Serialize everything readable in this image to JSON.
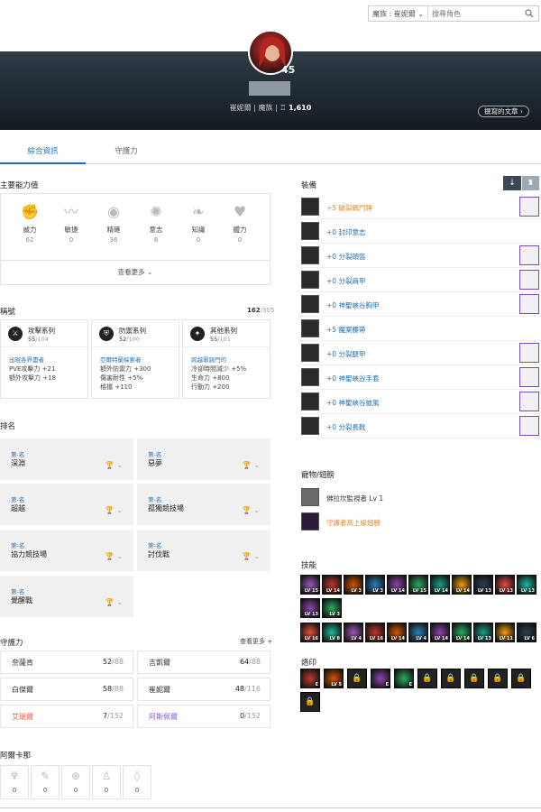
{
  "search": {
    "server": "魔族 : 崔妮爾 ⌄",
    "placeholder": "搜尋角色"
  },
  "profile": {
    "level": "45",
    "server": "崔妮爾",
    "race": "魔族",
    "sep": "|",
    "power": "1,610",
    "articles_button": "撰寫的文章 ›"
  },
  "tabs": [
    {
      "label": "綜合資訊"
    },
    {
      "label": "守護力"
    }
  ],
  "stats": {
    "title": "主要能力值",
    "items": [
      {
        "name": "威力",
        "value": "62"
      },
      {
        "name": "敏捷",
        "value": "0"
      },
      {
        "name": "精確",
        "value": "36"
      },
      {
        "name": "意志",
        "value": "8"
      },
      {
        "name": "知識",
        "value": "0"
      },
      {
        "name": "體力",
        "value": "0"
      }
    ],
    "more": "查看更多 ⌄"
  },
  "titles": {
    "title": "稱號",
    "count": "162",
    "total": "/305",
    "cards": [
      {
        "name": "攻擊系列",
        "count": "55",
        "total": "/104",
        "tag": "出現各界盡者",
        "lines": [
          "PVE攻擊力 +21",
          "額外攻擊力 +18"
        ]
      },
      {
        "name": "防禦系列",
        "count": "52",
        "total": "/100",
        "tag": "亞爾特蘭探索者",
        "lines": [
          "額外防禦力 +300",
          "傷害耐性 +5%",
          "格擋 +110"
        ]
      },
      {
        "name": "其他系列",
        "count": "55",
        "total": "/101",
        "tag": "跨越罪惡門的",
        "lines": [
          "冷卻時間減少 +5%",
          "生命力 +800",
          "行動力 +200"
        ]
      }
    ]
  },
  "ranking": {
    "title": "排名",
    "items": [
      {
        "label": "第-名",
        "name": "深淵",
        "trophy": "🏆 ⌄"
      },
      {
        "label": "第-名",
        "name": "惡夢",
        "trophy": "🏆 ⌄"
      },
      {
        "label": "第-名",
        "name": "超越",
        "trophy": "🏆 ⌄"
      },
      {
        "label": "第-名",
        "name": "孤獨競技場",
        "trophy": "🏆 ⌄"
      },
      {
        "label": "第-名",
        "name": "協力競技場",
        "trophy": "🏆 ⌄"
      },
      {
        "label": "第-名",
        "name": "討伐戰",
        "trophy": "🏆 ⌄"
      },
      {
        "label": "第-名",
        "name": "覺醒戰",
        "trophy": "🏆 ⌄"
      }
    ]
  },
  "guardian": {
    "title": "守護力",
    "more": "查看更多 +",
    "items": [
      {
        "name": "奈薩肯",
        "value": "52",
        "total": "/88",
        "color": "#333333"
      },
      {
        "name": "吉凱爾",
        "value": "64",
        "total": "/88",
        "color": "#333333"
      },
      {
        "name": "白傑爾",
        "value": "58",
        "total": "/88",
        "color": "#333333"
      },
      {
        "name": "崔妮爾",
        "value": "48",
        "total": "/116",
        "color": "#333333"
      },
      {
        "name": "艾瑞爾",
        "value": "7",
        "total": "/152",
        "color": "#e0614a"
      },
      {
        "name": "阿斯佩爾",
        "value": "0",
        "total": "/152",
        "color": "#8a5bd0"
      }
    ]
  },
  "cards": {
    "title": "阿爾卡那",
    "items": [
      {
        "value": "0"
      },
      {
        "value": "0"
      },
      {
        "value": "0"
      },
      {
        "value": "0"
      },
      {
        "value": "0"
      }
    ]
  },
  "equipment": {
    "title": "裝備",
    "items": [
      {
        "name": "+5 破裂戰鬥錘",
        "color": "#e08a2c",
        "side": true
      },
      {
        "name": "+0 封印意志",
        "color": "#1f6fb5",
        "side": false
      },
      {
        "name": "+0 分裂頭盔",
        "color": "#1f6fb5",
        "side": true
      },
      {
        "name": "+0 分裂肩甲",
        "color": "#1f6fb5",
        "side": true
      },
      {
        "name": "+0 神聖峽谷胸甲",
        "color": "#1f6fb5",
        "side": true
      },
      {
        "name": "+5 魔案腰帶",
        "color": "#1f6fb5",
        "side": false
      },
      {
        "name": "+0 分裂腿甲",
        "color": "#1f6fb5",
        "side": true
      },
      {
        "name": "+0 神聖峽谷手套",
        "color": "#1f6fb5",
        "side": true
      },
      {
        "name": "+0 神聖峽谷披風",
        "color": "#1f6fb5",
        "side": true
      },
      {
        "name": "+0 分裂長靴",
        "color": "#1f6fb5",
        "side": true
      }
    ]
  },
  "pets": {
    "title": "寵物/翅膀",
    "items": [
      {
        "name": "佛拉坎監視者 Lv 1",
        "color": "#333333"
      },
      {
        "name": "守護者高上級翅膀",
        "color": "#e08a2c"
      }
    ]
  },
  "skills": {
    "title": "技能",
    "row1": [
      "LV 15",
      "LV 14",
      "LV 3",
      "LV 3",
      "LV 14",
      "LV 15",
      "LV 14",
      "LV 14",
      "LV 13",
      "LV 13",
      "LV 13"
    ],
    "row2": [
      "LV 13",
      "LV 3"
    ],
    "row3": [
      "LV 16",
      "LV 8",
      "LV 4",
      "LV 16",
      "LV 14",
      "LV 4",
      "LV 14",
      "LV 14",
      "LV 13",
      "LV 11",
      "LV 6"
    ]
  },
  "stigma": {
    "title": "烙印",
    "items": [
      "E",
      "LV 5",
      "",
      "E",
      "E",
      "",
      "",
      "",
      "",
      "",
      ""
    ]
  }
}
